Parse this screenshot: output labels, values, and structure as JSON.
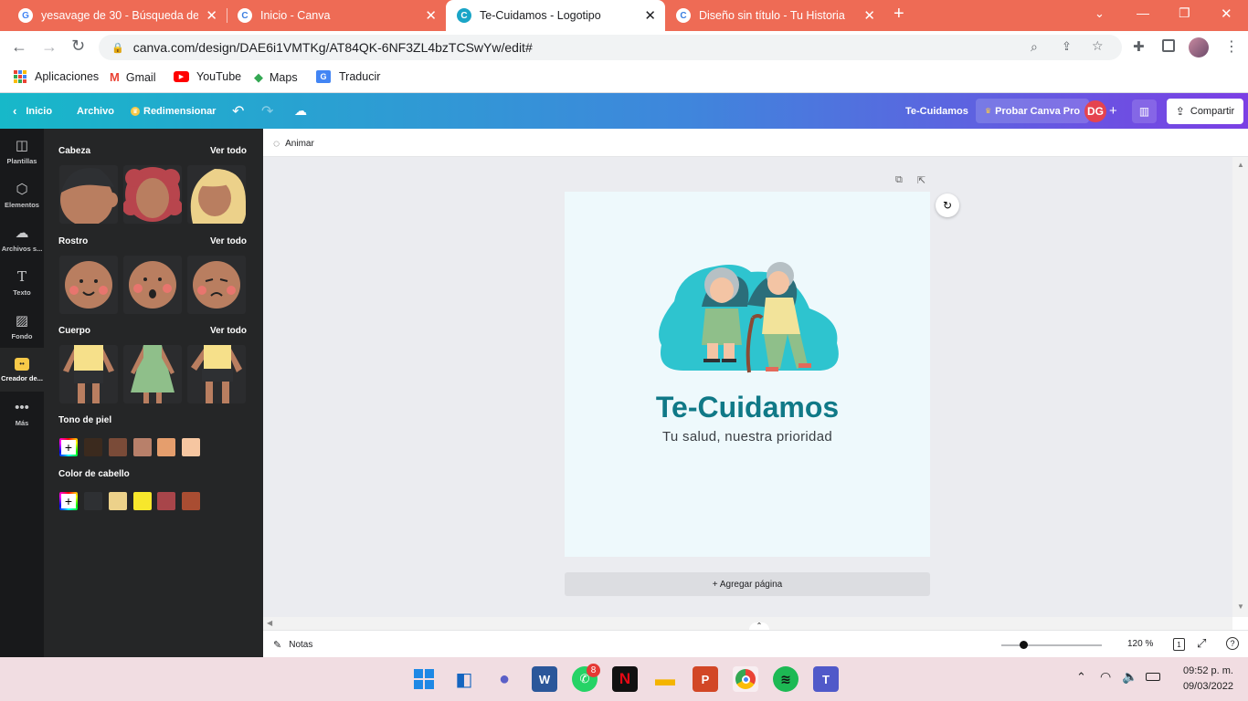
{
  "browser": {
    "tabs": [
      {
        "title": "yesavage de 30 - Búsqueda de G",
        "favicon": "google-g-icon",
        "active": false
      },
      {
        "title": "Inicio - Canva",
        "favicon": "canva-icon",
        "active": false
      },
      {
        "title": "Te-Cuidamos - Logotipo",
        "favicon": "canva-icon",
        "active": true
      },
      {
        "title": "Diseño sin título - Tu Historia",
        "favicon": "canva-icon",
        "active": false
      }
    ],
    "url": "canva.com/design/DAE6i1VMTKg/AT84QK-6NF3ZL4bzTCSwYw/edit#",
    "bookmarks": [
      {
        "label": "Aplicaciones",
        "icon": "apps-grid-icon"
      },
      {
        "label": "Gmail",
        "icon": "gmail-icon"
      },
      {
        "label": "YouTube",
        "icon": "youtube-icon"
      },
      {
        "label": "Maps",
        "icon": "maps-icon"
      },
      {
        "label": "Traducir",
        "icon": "translate-icon"
      }
    ],
    "tabbar_color": "#ee6b55"
  },
  "canva_top": {
    "home": "Inicio",
    "file": "Archivo",
    "resize": "Redimensionar",
    "design_name": "Te-Cuidamos",
    "try_pro": "Probar Canva Pro",
    "avatar": "DG",
    "share": "Compartir"
  },
  "rail": [
    {
      "label": "Plantillas",
      "icon": "templates-icon"
    },
    {
      "label": "Elementos",
      "icon": "elements-icon"
    },
    {
      "label": "Archivos s...",
      "icon": "upload-cloud-icon"
    },
    {
      "label": "Texto",
      "icon": "text-icon"
    },
    {
      "label": "Fondo",
      "icon": "background-icon"
    },
    {
      "label": "Creador de...",
      "icon": "character-builder-icon"
    },
    {
      "label": "Más",
      "icon": "more-dots-icon"
    }
  ],
  "panel": {
    "head": {
      "title": "Cabeza",
      "link": "Ver todo"
    },
    "face": {
      "title": "Rostro",
      "link": "Ver todo"
    },
    "body": {
      "title": "Cuerpo",
      "link": "Ver todo"
    },
    "skin": {
      "title": "Tono de piel",
      "colors": [
        "#3b2a1e",
        "#7a4b38",
        "#b8806a",
        "#e59e6d",
        "#f6c6a1"
      ]
    },
    "hair": {
      "title": "Color de cabello",
      "colors": [
        "#2e3033",
        "#ecd18a",
        "#f7e72c",
        "#a8454a",
        "#a94d32"
      ]
    }
  },
  "workspace": {
    "animate": "Animar",
    "logo_title": "Te-Cuidamos",
    "logo_subtitle": "Tu salud, nuestra prioridad",
    "add_page": "+ Agregar página",
    "notes": "Notas",
    "zoom": "120 %",
    "page_num": "1"
  },
  "taskbar": {
    "whatsapp_badge": "8",
    "time": "09:52 p. m.",
    "date": "09/03/2022"
  }
}
